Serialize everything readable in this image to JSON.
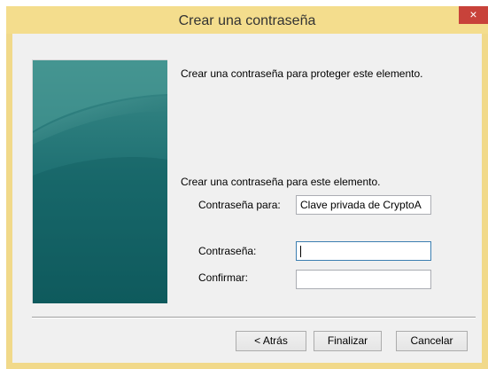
{
  "window": {
    "title": "Crear una contraseña",
    "close_label": "×"
  },
  "content": {
    "intro": "Crear una contraseña para proteger este elemento.",
    "section_heading": "Crear una contraseña para este elemento.",
    "password_for_label": "Contraseña para:",
    "password_for_value": "Clave privada de CryptoA",
    "password_label": "Contraseña:",
    "password_value": "",
    "confirm_label": "Confirmar:",
    "confirm_value": ""
  },
  "buttons": {
    "back": "< Atrás",
    "finish": "Finalizar",
    "cancel": "Cancelar"
  },
  "colors": {
    "titlebar": "#f4dd8d",
    "close_button": "#c8423a",
    "banner_teal": "#16666a"
  }
}
